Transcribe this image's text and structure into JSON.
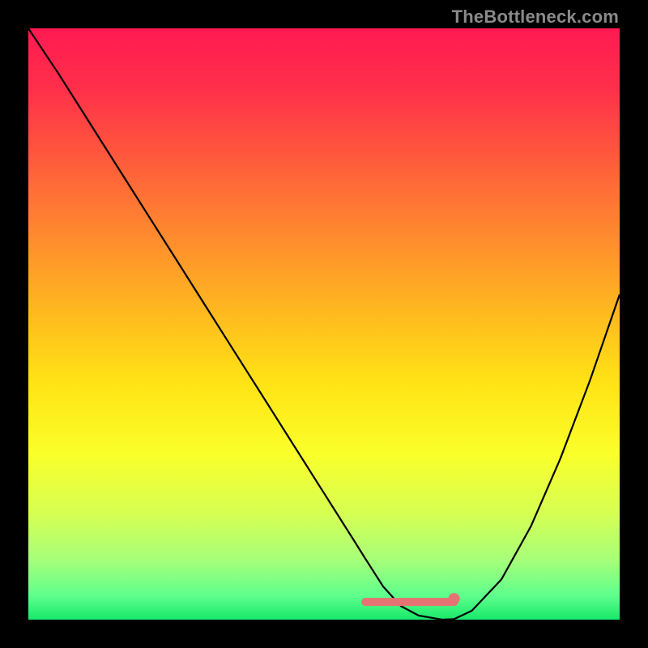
{
  "watermark": "TheBottleneck.com",
  "gradient": {
    "stops": [
      {
        "offset": 0.0,
        "color": "#ff1a52"
      },
      {
        "offset": 0.1,
        "color": "#ff2f4a"
      },
      {
        "offset": 0.22,
        "color": "#ff5a3c"
      },
      {
        "offset": 0.35,
        "color": "#ff8a2e"
      },
      {
        "offset": 0.48,
        "color": "#ffb91f"
      },
      {
        "offset": 0.6,
        "color": "#ffe315"
      },
      {
        "offset": 0.72,
        "color": "#faff2a"
      },
      {
        "offset": 0.82,
        "color": "#d6ff52"
      },
      {
        "offset": 0.9,
        "color": "#a6ff7a"
      },
      {
        "offset": 0.96,
        "color": "#5eff8d"
      },
      {
        "offset": 1.0,
        "color": "#18e86a"
      }
    ]
  },
  "chart_data": {
    "type": "line",
    "title": "",
    "xlabel": "",
    "ylabel": "",
    "xlim": [
      0,
      100
    ],
    "ylim": [
      0,
      100
    ],
    "x": [
      0,
      5,
      10,
      15,
      20,
      25,
      30,
      35,
      40,
      45,
      50,
      55,
      57,
      60,
      63,
      66,
      70,
      72,
      75,
      80,
      85,
      90,
      95,
      100
    ],
    "values": [
      100,
      92.5,
      84.6,
      76.7,
      68.8,
      60.9,
      53.0,
      45.1,
      37.2,
      29.3,
      21.4,
      13.5,
      10.3,
      5.6,
      2.3,
      0.7,
      0.0,
      0.1,
      1.5,
      6.8,
      15.8,
      27.3,
      40.5,
      55.0
    ],
    "annotations": {
      "flat_zone": {
        "x_start": 57,
        "x_end": 72,
        "y": 3.0,
        "color": "#e57373"
      }
    }
  },
  "colors": {
    "curve": "#000000",
    "flat_marker": "#e57373",
    "frame": "#000000"
  }
}
